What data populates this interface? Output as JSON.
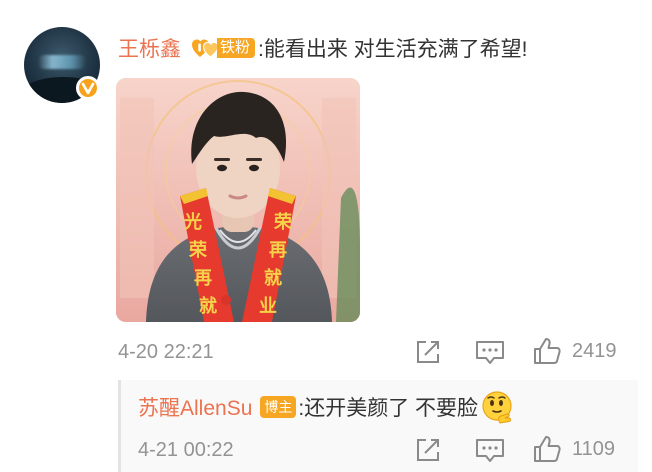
{
  "comment": {
    "username": "王栎鑫",
    "fan_badge": "铁粉",
    "text": ":能看出来 对生活充满了希望!",
    "time": "4-20 22:21",
    "like_count": "2419",
    "photo_banner_left": [
      "光",
      "荣",
      "再",
      "就"
    ],
    "photo_banner_right": [
      "荣",
      "再",
      "就",
      "业"
    ]
  },
  "reply": {
    "username": "苏醒AllenSu",
    "author_tag": "博主",
    "text": ":还开美颜了 不要脸",
    "emoji": "thinking-face",
    "time": "4-21 00:22",
    "like_count": "1109"
  },
  "icons": {
    "share": "share-icon",
    "comment": "comment-icon",
    "like": "thumbs-up-icon",
    "verify": "verified-v-icon"
  },
  "colors": {
    "username": "#eb7350",
    "badge": "#f6a623",
    "verify_badge": "#f7a21b",
    "meta": "#939393",
    "text": "#333333"
  }
}
